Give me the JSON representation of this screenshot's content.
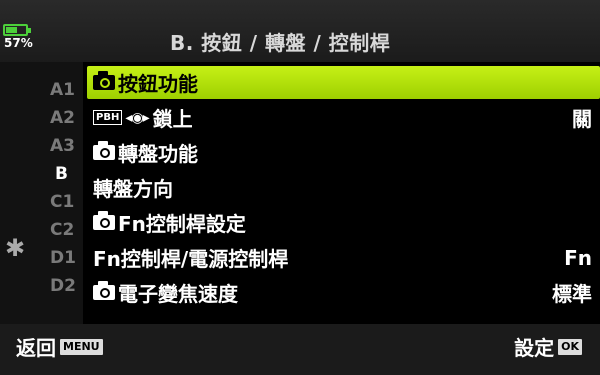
{
  "status": {
    "battery_percent": "57%",
    "battery_color": "#4cd03a"
  },
  "header": {
    "title": "B. 按鈕 / 轉盤 / 控制桿"
  },
  "sidebar": {
    "tabs": [
      "A1",
      "A2",
      "A3",
      "B",
      "C1",
      "C2",
      "D1",
      "D2"
    ],
    "active_tab": "B",
    "settings_icon": "gear-icon"
  },
  "menu": {
    "accent_color": "#b8e50c",
    "items": [
      {
        "icon": "camera-icon",
        "label": "按鈕功能",
        "value": ""
      },
      {
        "icon": "pbh-lock-icon",
        "icon_text": "PBH",
        "label": "鎖上",
        "value": "關"
      },
      {
        "icon": "camera-icon",
        "label": "轉盤功能",
        "value": ""
      },
      {
        "icon": "",
        "label": "轉盤方向",
        "value": ""
      },
      {
        "icon": "camera-icon",
        "label": "Fn控制桿設定",
        "value": ""
      },
      {
        "icon": "",
        "label": "Fn控制桿/電源控制桿",
        "value": "Fn"
      },
      {
        "icon": "camera-icon",
        "label": "電子變焦速度",
        "value": "標準"
      }
    ]
  },
  "footer": {
    "back_label": "返回",
    "back_key": "MENU",
    "set_label": "設定",
    "set_key": "OK"
  }
}
